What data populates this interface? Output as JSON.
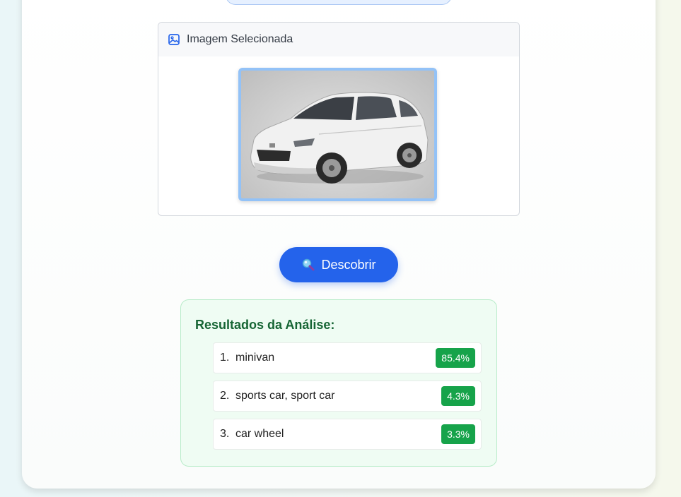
{
  "preview": {
    "title": "Imagem Selecionada",
    "image_icon": "image-icon",
    "photo_subject": "car-photo"
  },
  "action": {
    "button_label": "Descobrir",
    "button_icon": "magnifier-icon"
  },
  "results": {
    "title": "Resultados da Análise:",
    "items": [
      {
        "rank": "1.",
        "label": "minivan",
        "score": "85.4%"
      },
      {
        "rank": "2.",
        "label": "sports car, sport car",
        "score": "4.3%"
      },
      {
        "rank": "3.",
        "label": "car wheel",
        "score": "3.3%"
      }
    ]
  },
  "colors": {
    "accent": "#2463eb",
    "success": "#16a34a",
    "results_title": "#166534"
  }
}
